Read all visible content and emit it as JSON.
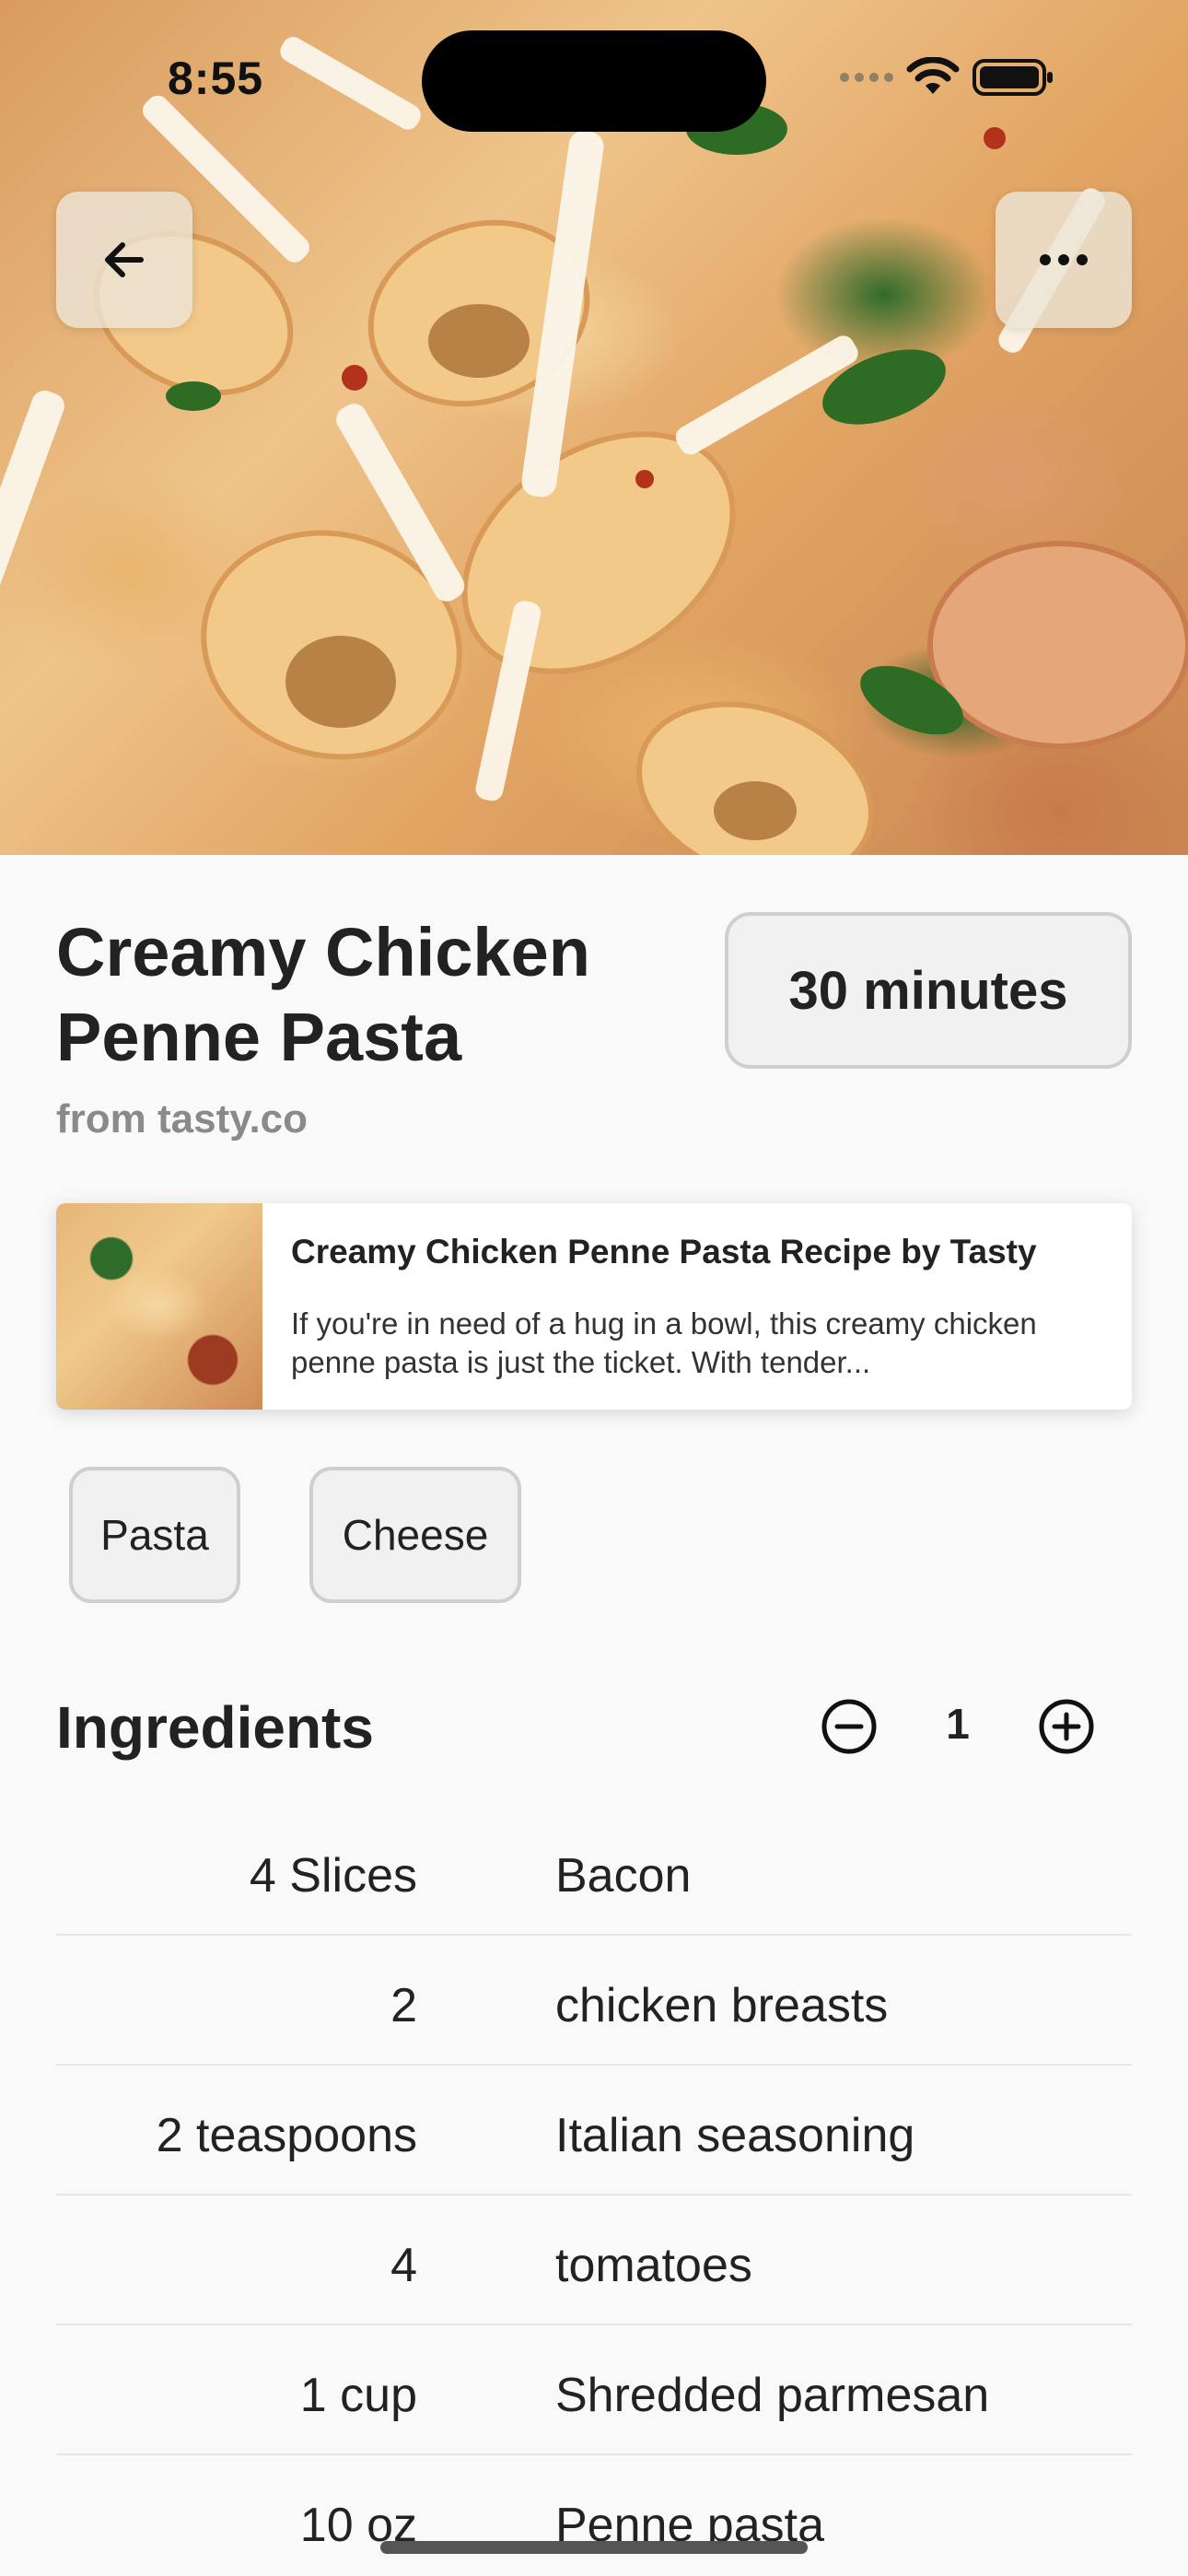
{
  "status_bar": {
    "time": "8:55"
  },
  "nav": {
    "back_icon": "arrow-left-icon",
    "more_icon": "ellipsis-icon"
  },
  "recipe": {
    "title": "Creamy Chicken Penne Pasta",
    "source": "from tasty.co",
    "duration": "30 minutes"
  },
  "link_preview": {
    "title": "Creamy Chicken Penne Pasta Recipe by Tasty",
    "description": "If you're in need of a hug in a bowl, this creamy chicken penne pasta is just the ticket. With tender..."
  },
  "tags": [
    "Pasta",
    "Cheese"
  ],
  "ingredients": {
    "heading": "Ingredients",
    "servings": "1",
    "items": [
      {
        "qty": "4 Slices",
        "name": "Bacon"
      },
      {
        "qty": "2",
        "name": "chicken breasts"
      },
      {
        "qty": "2 teaspoons",
        "name": "Italian seasoning"
      },
      {
        "qty": "4",
        "name": "tomatoes"
      },
      {
        "qty": "1 cup",
        "name": "Shredded parmesan"
      },
      {
        "qty": "10 oz",
        "name": "Penne pasta"
      }
    ]
  }
}
